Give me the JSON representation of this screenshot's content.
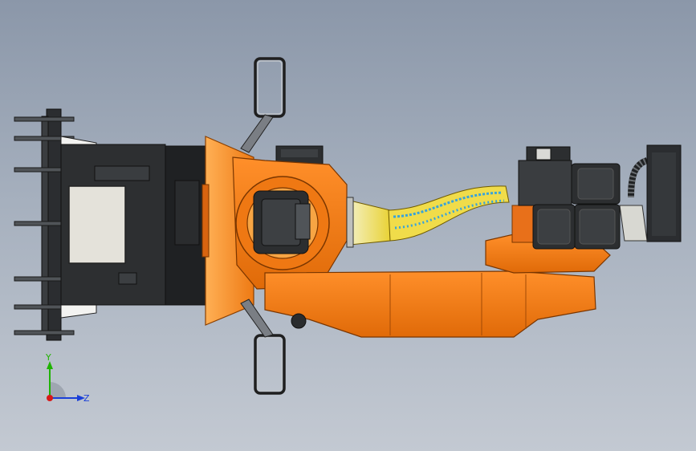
{
  "viewport": {
    "background_top": "#8b97a9",
    "background_bottom": "#c3c9d2"
  },
  "model": {
    "colors": {
      "orange": "#f07a12",
      "orange_dark": "#c65a05",
      "orange_light": "#ff9a35",
      "dark": "#2a2c2e",
      "dark_mid": "#3c3f42",
      "gray_panel": "#e4e2da",
      "hose_yellow": "#f2e155",
      "hose_blue": "#3aa3d8"
    }
  },
  "triad": {
    "y_label": "Y",
    "z_label": "Z",
    "y_color": "#1fb300",
    "z_color": "#1a3fd8",
    "x_color": "#d81818"
  }
}
